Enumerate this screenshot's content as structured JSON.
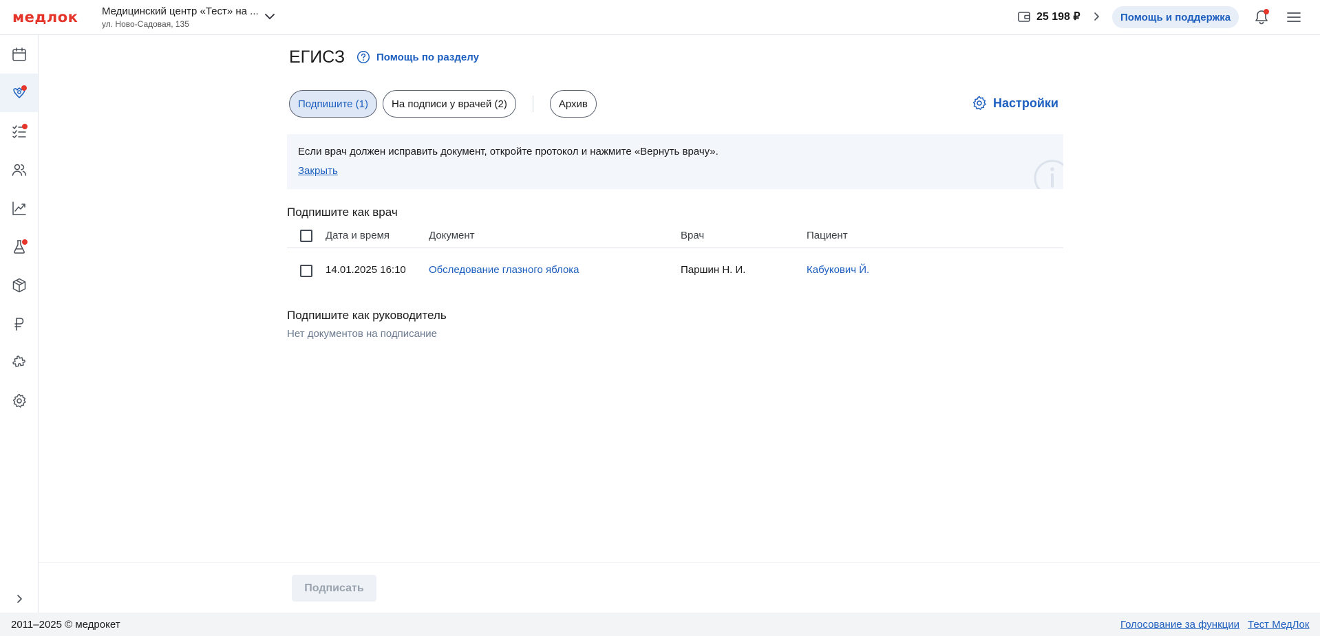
{
  "header": {
    "logo": "медлок",
    "clinic_name": "Медицинский центр «Тест» на ...",
    "clinic_address": "ул. Ново-Садовая, 135",
    "balance": "25 198 ₽",
    "help_label": "Помощь и поддержка"
  },
  "sidebar": {
    "items": [
      {
        "icon": "calendar-icon",
        "active": false,
        "badge": false
      },
      {
        "icon": "egisz-emblem-icon",
        "active": true,
        "badge": true
      },
      {
        "icon": "task-list-icon",
        "active": false,
        "badge": true
      },
      {
        "icon": "patients-icon",
        "active": false,
        "badge": false
      },
      {
        "icon": "analytics-chart-icon",
        "active": false,
        "badge": false
      },
      {
        "icon": "lab-flask-icon",
        "active": false,
        "badge": true
      },
      {
        "icon": "box-icon",
        "active": false,
        "badge": false
      },
      {
        "icon": "ruble-icon",
        "active": false,
        "badge": false
      },
      {
        "icon": "puzzle-icon",
        "active": false,
        "badge": false
      },
      {
        "icon": "gear-icon",
        "active": false,
        "badge": false
      }
    ]
  },
  "page": {
    "title": "ЕГИСЗ",
    "section_help": "Помощь по разделу",
    "tabs": [
      {
        "label": "Подпишите (1)",
        "active": true
      },
      {
        "label": "На подписи у врачей (2)",
        "active": false
      },
      {
        "label": "Архив",
        "active": false
      }
    ],
    "settings_label": "Настройки"
  },
  "info": {
    "text": "Если врач должен исправить документ, откройте протокол и нажмите «Вернуть врачу».",
    "close_label": "Закрыть"
  },
  "doctor_section": {
    "heading": "Подпишите как врач",
    "columns": [
      "Дата и время",
      "Документ",
      "Врач",
      "Пациент"
    ],
    "rows": [
      {
        "datetime": "14.01.2025 16:10",
        "document": "Обследование глазного яблока",
        "doctor": "Паршин Н. И.",
        "patient": "Кабукович Й."
      }
    ]
  },
  "manager_section": {
    "heading": "Подпишите как руководитель",
    "empty_text": "Нет документов на подписание"
  },
  "actions": {
    "sign_label": "Подписать"
  },
  "footer": {
    "copyright": "2011–2025 © медрокет",
    "vote_link": "Голосование за функции",
    "test_link": "Тест МедЛок"
  },
  "colors": {
    "accent": "#1d5fbf",
    "brand": "#e5362c",
    "badge": "#e5362c"
  }
}
